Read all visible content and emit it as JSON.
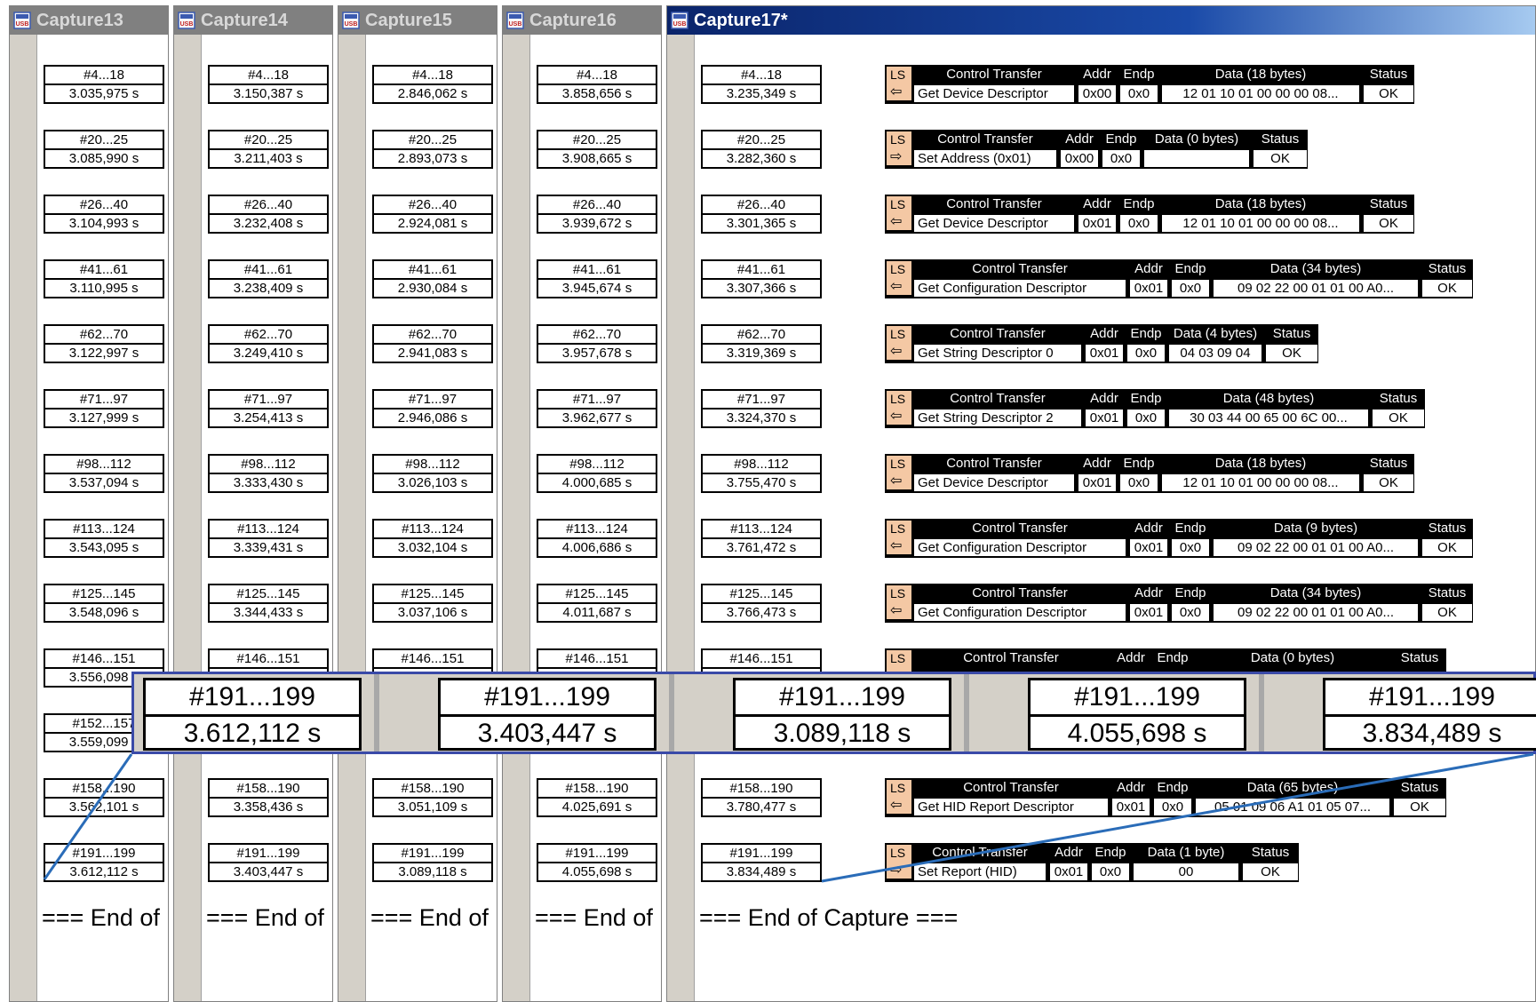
{
  "windows": [
    {
      "title": "Capture13",
      "active": false,
      "end_text": "=== End of",
      "rows": [
        [
          "#4...18",
          "3.035,975 s"
        ],
        [
          "#20...25",
          "3.085,990 s"
        ],
        [
          "#26...40",
          "3.104,993 s"
        ],
        [
          "#41...61",
          "3.110,995 s"
        ],
        [
          "#62...70",
          "3.122,997 s"
        ],
        [
          "#71...97",
          "3.127,999 s"
        ],
        [
          "#98...112",
          "3.537,094 s"
        ],
        [
          "#113...124",
          "3.543,095 s"
        ],
        [
          "#125...145",
          "3.548,096 s"
        ],
        [
          "#146...151",
          "3.556,098 s"
        ],
        [
          "#152...157",
          "3.559,099 s"
        ],
        [
          "#158...190",
          "3.562,101 s"
        ],
        [
          "#191...199",
          "3.612,112 s"
        ]
      ]
    },
    {
      "title": "Capture14",
      "active": false,
      "end_text": "=== End of",
      "rows": [
        [
          "#4...18",
          "3.150,387 s"
        ],
        [
          "#20...25",
          "3.211,403 s"
        ],
        [
          "#26...40",
          "3.232,408 s"
        ],
        [
          "#41...61",
          "3.238,409 s"
        ],
        [
          "#62...70",
          "3.249,410 s"
        ],
        [
          "#71...97",
          "3.254,413 s"
        ],
        [
          "#98...112",
          "3.333,430 s"
        ],
        [
          "#113...124",
          "3.339,431 s"
        ],
        [
          "#125...145",
          "3.344,433 s"
        ],
        [
          "#146...151",
          ""
        ],
        [
          "",
          ""
        ],
        [
          "#158...190",
          "3.358,436 s"
        ],
        [
          "#191...199",
          "3.403,447 s"
        ]
      ]
    },
    {
      "title": "Capture15",
      "active": false,
      "end_text": "=== End of",
      "rows": [
        [
          "#4...18",
          "2.846,062 s"
        ],
        [
          "#20...25",
          "2.893,073 s"
        ],
        [
          "#26...40",
          "2.924,081 s"
        ],
        [
          "#41...61",
          "2.930,084 s"
        ],
        [
          "#62...70",
          "2.941,083 s"
        ],
        [
          "#71...97",
          "2.946,086 s"
        ],
        [
          "#98...112",
          "3.026,103 s"
        ],
        [
          "#113...124",
          "3.032,104 s"
        ],
        [
          "#125...145",
          "3.037,106 s"
        ],
        [
          "#146...151",
          ""
        ],
        [
          "",
          ""
        ],
        [
          "#158...190",
          "3.051,109 s"
        ],
        [
          "#191...199",
          "3.089,118 s"
        ]
      ]
    },
    {
      "title": "Capture16",
      "active": false,
      "end_text": "=== End of",
      "rows": [
        [
          "#4...18",
          "3.858,656 s"
        ],
        [
          "#20...25",
          "3.908,665 s"
        ],
        [
          "#26...40",
          "3.939,672 s"
        ],
        [
          "#41...61",
          "3.945,674 s"
        ],
        [
          "#62...70",
          "3.957,678 s"
        ],
        [
          "#71...97",
          "3.962,677 s"
        ],
        [
          "#98...112",
          "4.000,685 s"
        ],
        [
          "#113...124",
          "4.006,686 s"
        ],
        [
          "#125...145",
          "4.011,687 s"
        ],
        [
          "#146...151",
          ""
        ],
        [
          "",
          ""
        ],
        [
          "#158...190",
          "4.025,691 s"
        ],
        [
          "#191...199",
          "4.055,698 s"
        ]
      ]
    },
    {
      "title": "Capture17*",
      "active": true,
      "end_text": "=== End of Capture ===",
      "rows": [
        [
          "#4...18",
          "3.235,349 s"
        ],
        [
          "#20...25",
          "3.282,360 s"
        ],
        [
          "#26...40",
          "3.301,365 s"
        ],
        [
          "#41...61",
          "3.307,366 s"
        ],
        [
          "#62...70",
          "3.319,369 s"
        ],
        [
          "#71...97",
          "3.324,370 s"
        ],
        [
          "#98...112",
          "3.755,470 s"
        ],
        [
          "#113...124",
          "3.761,472 s"
        ],
        [
          "#125...145",
          "3.766,473 s"
        ],
        [
          "#146...151",
          ""
        ],
        [
          "",
          ""
        ],
        [
          "#158...190",
          "3.780,477 s"
        ],
        [
          "#191...199",
          "3.834,489 s"
        ]
      ]
    }
  ],
  "transfers": [
    {
      "ls": "LS",
      "dir": "in",
      "type": "Control Transfer",
      "addr_h": "Addr",
      "endp_h": "Endp",
      "data_h": "Data (18 bytes)",
      "status_h": "Status",
      "cmd": "Get Device Descriptor",
      "addr": "0x00",
      "endp": "0x0",
      "data": "12 01 10 01 00 00 00 08...",
      "status": "OK"
    },
    {
      "ls": "LS",
      "dir": "out",
      "type": "Control Transfer",
      "addr_h": "Addr",
      "endp_h": "Endp",
      "data_h": "Data (0 bytes)",
      "status_h": "Status",
      "cmd": "Set Address (0x01)",
      "addr": "0x00",
      "endp": "0x0",
      "data": "",
      "status": "OK"
    },
    {
      "ls": "LS",
      "dir": "in",
      "type": "Control Transfer",
      "addr_h": "Addr",
      "endp_h": "Endp",
      "data_h": "Data (18 bytes)",
      "status_h": "Status",
      "cmd": "Get Device Descriptor",
      "addr": "0x01",
      "endp": "0x0",
      "data": "12 01 10 01 00 00 00 08...",
      "status": "OK"
    },
    {
      "ls": "LS",
      "dir": "in",
      "type": "Control Transfer",
      "addr_h": "Addr",
      "endp_h": "Endp",
      "data_h": "Data (34 bytes)",
      "status_h": "Status",
      "cmd": "Get Configuration Descriptor",
      "addr": "0x01",
      "endp": "0x0",
      "data": "09 02 22 00 01 01 00 A0...",
      "status": "OK"
    },
    {
      "ls": "LS",
      "dir": "in",
      "type": "Control Transfer",
      "addr_h": "Addr",
      "endp_h": "Endp",
      "data_h": "Data (4 bytes)",
      "status_h": "Status",
      "cmd": "Get String Descriptor 0",
      "addr": "0x01",
      "endp": "0x0",
      "data": "04 03 09 04",
      "status": "OK"
    },
    {
      "ls": "LS",
      "dir": "in",
      "type": "Control Transfer",
      "addr_h": "Addr",
      "endp_h": "Endp",
      "data_h": "Data (48 bytes)",
      "status_h": "Status",
      "cmd": "Get String Descriptor 2",
      "addr": "0x01",
      "endp": "0x0",
      "data": "30 03 44 00 65 00 6C 00...",
      "status": "OK"
    },
    {
      "ls": "LS",
      "dir": "in",
      "type": "Control Transfer",
      "addr_h": "Addr",
      "endp_h": "Endp",
      "data_h": "Data (18 bytes)",
      "status_h": "Status",
      "cmd": "Get Device Descriptor",
      "addr": "0x01",
      "endp": "0x0",
      "data": "12 01 10 01 00 00 00 08...",
      "status": "OK"
    },
    {
      "ls": "LS",
      "dir": "in",
      "type": "Control Transfer",
      "addr_h": "Addr",
      "endp_h": "Endp",
      "data_h": "Data (9 bytes)",
      "status_h": "Status",
      "cmd": "Get Configuration Descriptor",
      "addr": "0x01",
      "endp": "0x0",
      "data": "09 02 22 00 01 01 00 A0...",
      "status": "OK"
    },
    {
      "ls": "LS",
      "dir": "in",
      "type": "Control Transfer",
      "addr_h": "Addr",
      "endp_h": "Endp",
      "data_h": "Data (34 bytes)",
      "status_h": "Status",
      "cmd": "Get Configuration Descriptor",
      "addr": "0x01",
      "endp": "0x0",
      "data": "09 02 22 00 01 01 00 A0...",
      "status": "OK"
    },
    {
      "ls": "LS",
      "dir": "out",
      "type": "Control Transfer",
      "addr_h": "Addr",
      "endp_h": "Endp",
      "data_h": "Data (0 bytes)",
      "status_h": "Status",
      "cmd": "",
      "addr": "",
      "endp": "",
      "data": "",
      "status": ""
    },
    null,
    {
      "ls": "LS",
      "dir": "in",
      "type": "Control Transfer",
      "addr_h": "Addr",
      "endp_h": "Endp",
      "data_h": "Data (65 bytes)",
      "status_h": "Status",
      "cmd": "Get HID Report Descriptor",
      "addr": "0x01",
      "endp": "0x0",
      "data": "05 01 09 06 A1 01 05 07...",
      "status": "OK"
    },
    {
      "ls": "LS",
      "dir": "out",
      "type": "Control Transfer",
      "addr_h": "Addr",
      "endp_h": "Endp",
      "data_h": "Data (1 byte)",
      "status_h": "Status",
      "cmd": "Set Report (HID)",
      "addr": "0x01",
      "endp": "0x0",
      "data": "00",
      "status": "OK"
    }
  ],
  "zoom": [
    {
      "range": "#191...199",
      "time": "3.612,112 s"
    },
    {
      "range": "#191...199",
      "time": "3.403,447 s"
    },
    {
      "range": "#191...199",
      "time": "3.089,118 s"
    },
    {
      "range": "#191...199",
      "time": "4.055,698 s"
    },
    {
      "range": "#191...199",
      "time": "3.834,489 s"
    }
  ],
  "icons": {
    "app": "usb-analyzer-app-icon",
    "dir_in": "arrow-left-icon",
    "dir_out": "arrow-right-icon"
  },
  "colors": {
    "active_title": "#0a246a",
    "inactive_title": "#808080",
    "ls_cell": "#f4c8a4",
    "zoom_border": "#3a4aa8",
    "connector": "#2a6cb8"
  }
}
